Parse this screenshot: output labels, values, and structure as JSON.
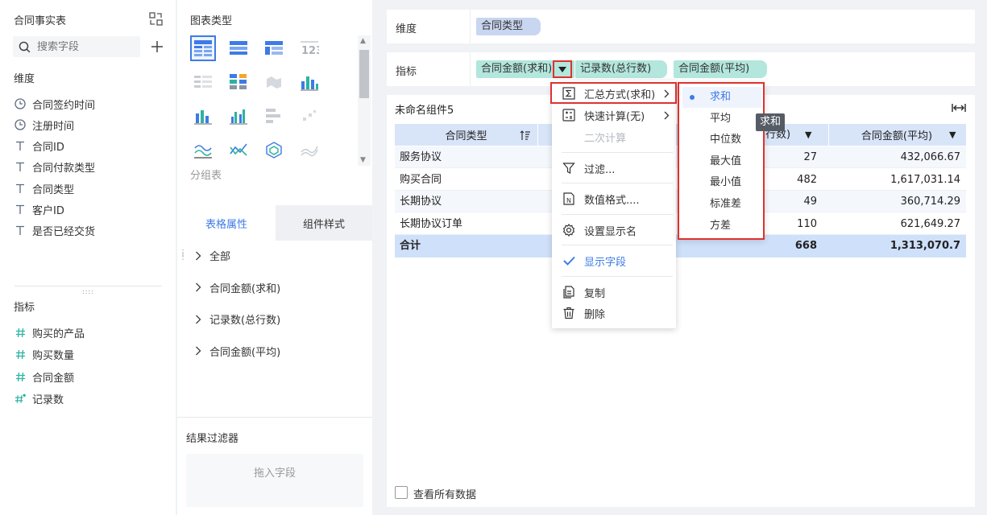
{
  "left_panel": {
    "title": "合同事实表",
    "search_placeholder": "搜索字段",
    "dimension_header": "维度",
    "dimensions": [
      {
        "icon": "clock-icon",
        "label": "合同签约时间"
      },
      {
        "icon": "clock-icon",
        "label": "注册时间"
      },
      {
        "icon": "text-type-icon",
        "label": "合同ID"
      },
      {
        "icon": "text-type-icon",
        "label": "合同付款类型"
      },
      {
        "icon": "text-type-icon",
        "label": "合同类型"
      },
      {
        "icon": "text-type-icon",
        "label": "客户ID"
      },
      {
        "icon": "text-type-icon",
        "label": "是否已经交货"
      }
    ],
    "metric_header": "指标",
    "metrics": [
      {
        "icon": "number-type-icon",
        "label": "购买的产品"
      },
      {
        "icon": "number-type-icon",
        "label": "购买数量"
      },
      {
        "icon": "number-type-icon",
        "label": "合同金额"
      },
      {
        "icon": "record-count-icon",
        "label": "记录数"
      }
    ]
  },
  "middle_panel": {
    "chart_type_title": "图表类型",
    "group_table_label": "分组表",
    "tabs": [
      "表格属性",
      "组件样式"
    ],
    "active_tab": 0,
    "tree": [
      "全部",
      "合同金额(求和)",
      "记录数(总行数)",
      "合同金额(平均)"
    ],
    "result_filter_title": "结果过滤器",
    "drop_hint": "拖入字段"
  },
  "config": {
    "dimension_label": "维度",
    "dimension_tags": [
      "合同类型"
    ],
    "metric_label": "指标",
    "metric_tags": [
      "合同金额(求和)",
      "记录数(总行数)",
      "合同金额(平均)"
    ]
  },
  "table": {
    "component_name": "未命名组件5",
    "headers": [
      "合同类型",
      "记录数(总行数)",
      "合同金额(平均)"
    ],
    "header_partial": "行数)",
    "rows": [
      {
        "type": "服务协议",
        "count": "27",
        "avg": "432,066.67"
      },
      {
        "type": "购买合同",
        "count": "482",
        "avg": "1,617,031.14"
      },
      {
        "type": "长期协议",
        "count": "49",
        "avg": "360,714.29"
      },
      {
        "type": "长期协议订单",
        "count": "110",
        "avg": "621,649.27"
      }
    ],
    "total": {
      "type": "合计",
      "count": "668",
      "avg": "1,313,070.7"
    },
    "view_all_label": "查看所有数据"
  },
  "context_menu": {
    "items": [
      {
        "icon": "sigma-icon",
        "label": "汇总方式(求和)",
        "has_sub": true
      },
      {
        "icon": "quick-calc-icon",
        "label": "快速计算(无)",
        "has_sub": true
      },
      {
        "icon": "",
        "label": "二次计算",
        "disabled": true
      },
      {
        "icon": "filter-icon",
        "label": "过滤..."
      },
      {
        "icon": "number-format-icon",
        "label": "数值格式...."
      },
      {
        "icon": "settings-icon",
        "label": "设置显示名"
      },
      {
        "icon": "check-icon",
        "label": "显示字段",
        "active": true
      },
      {
        "icon": "copy-icon",
        "label": "复制"
      },
      {
        "icon": "delete-icon",
        "label": "删除"
      }
    ]
  },
  "submenu": {
    "items": [
      "求和",
      "平均",
      "中位数",
      "最大值",
      "最小值",
      "标准差",
      "方差"
    ],
    "selected": 0,
    "tooltip": "求和"
  },
  "colors": {
    "accent": "#3d7be6",
    "dim_tag": "#c9d6f1",
    "metric_tag": "#b3e6dc",
    "header_bg": "#d8e4f8",
    "total_bg": "#cfe0fa",
    "highlight_border": "#e0312e"
  }
}
